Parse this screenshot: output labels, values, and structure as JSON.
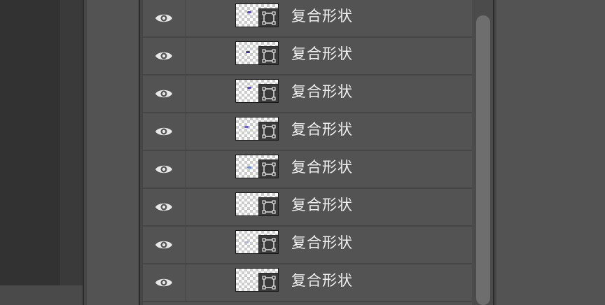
{
  "layers_panel": {
    "layers": [
      {
        "name": "复合形状",
        "thumb_color": "#5a4fb8",
        "visible": true
      },
      {
        "name": "复合形状",
        "thumb_color": "#3d35a6",
        "visible": true
      },
      {
        "name": "复合形状",
        "thumb_color": "#5a4fb8",
        "visible": true
      },
      {
        "name": "复合形状",
        "thumb_color": "#6a5fd0",
        "visible": true
      },
      {
        "name": "复合形状",
        "thumb_color": "#6a8fd8",
        "visible": true
      },
      {
        "name": "复合形状",
        "thumb_color": "",
        "visible": true
      },
      {
        "name": "复合形状",
        "thumb_color": "#a9b8e8",
        "visible": true
      },
      {
        "name": "复合形状",
        "thumb_color": "",
        "visible": true
      }
    ],
    "icons": {
      "visibility": "eye-icon",
      "vector_mask": "vector-mask-icon"
    }
  },
  "colors": {
    "panel_bg": "#535353",
    "row_divider": "#464646",
    "text": "#f0f0f0",
    "scrollbar_thumb": "#6e6e6e"
  }
}
